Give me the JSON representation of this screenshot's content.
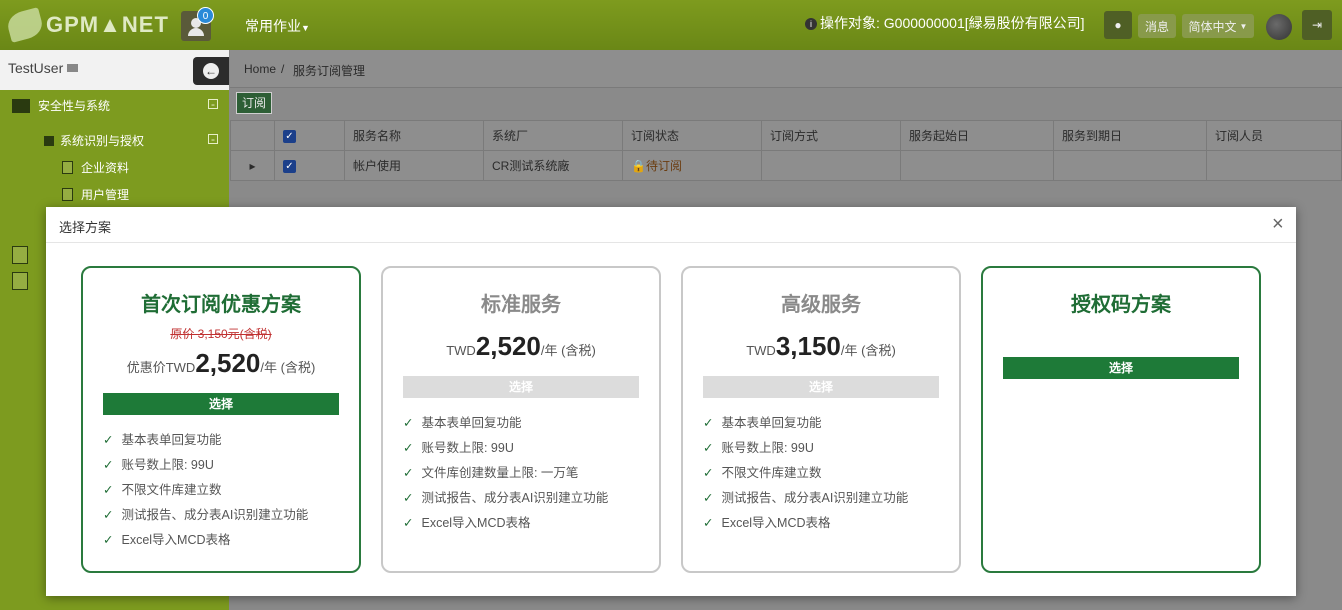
{
  "topbar": {
    "logo_text": "GPM▲NET",
    "notif_count": "0",
    "menu_label": "常用作业",
    "target_label": "操作对象: G000000001[緑易股份有限公司]",
    "msg_label": "消息",
    "lang_label": "简体中文"
  },
  "sidebar": {
    "username": "TestUser",
    "group_label": "安全性与系统",
    "sub_label": "系统识别与授权",
    "items": [
      "企业资料",
      "用户管理"
    ]
  },
  "breadcrumb": {
    "home": "Home",
    "separator": "/",
    "current": "服务订阅管理"
  },
  "toolbar": {
    "subscribe_label": "订阅"
  },
  "grid": {
    "headers": [
      "服务名称",
      "系统厂",
      "订阅状态",
      "订阅方式",
      "服务起始日",
      "服务到期日",
      "订阅人员"
    ],
    "row": {
      "name": "帐户使用",
      "vendor": "CR测试系统廠",
      "status": "待订阅",
      "method": "",
      "start": "",
      "end": "",
      "person": ""
    }
  },
  "modal": {
    "title": "选择方案",
    "close": "×",
    "plans": [
      {
        "title": "首次订阅优惠方案",
        "original": "原价 3,150元(含税)",
        "price_prefix": "优惠价TWD",
        "price": "2,520",
        "price_suffix": "/年 (含税)",
        "button": "选择",
        "features": [
          "基本表单回复功能",
          "账号数上限: 99U",
          "不限文件库建立数",
          "测试报告、成分表AI识别建立功能",
          "Excel导入MCD表格"
        ]
      },
      {
        "title": "标准服务",
        "price_prefix": "TWD",
        "price": "2,520",
        "price_suffix": "/年 (含税)",
        "button": "选择",
        "features": [
          "基本表单回复功能",
          "账号数上限: 99U",
          "文件库创建数量上限: 一万笔",
          "测试报告、成分表AI识别建立功能",
          "Excel导入MCD表格"
        ]
      },
      {
        "title": "高级服务",
        "price_prefix": "TWD",
        "price": "3,150",
        "price_suffix": "/年 (含税)",
        "button": "选择",
        "features": [
          "基本表单回复功能",
          "账号数上限: 99U",
          "不限文件库建立数",
          "测试报告、成分表AI识别建立功能",
          "Excel导入MCD表格"
        ]
      },
      {
        "title": "授权码方案",
        "button": "选择"
      }
    ],
    "check_mark": "✓"
  }
}
